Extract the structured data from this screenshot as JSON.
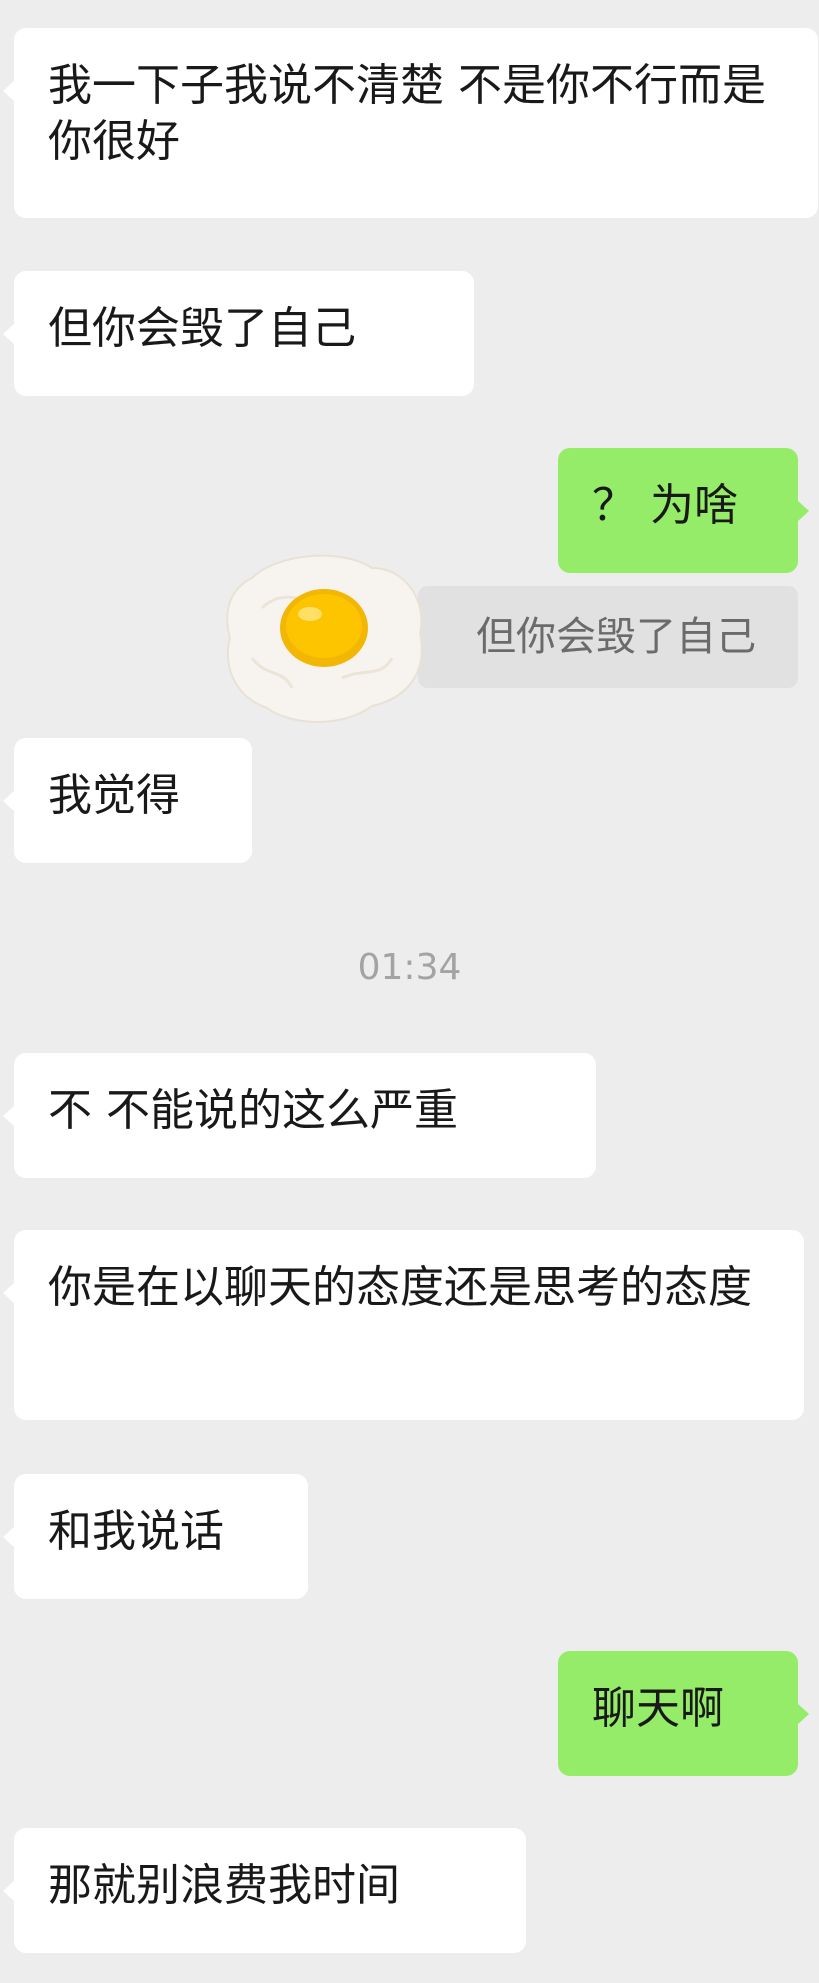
{
  "messages": [
    {
      "text": "我一下子我说不清楚 不是你不行而是你很好"
    },
    {
      "text": "但你会毁了自己"
    },
    {
      "text": "？ 为啥"
    },
    {
      "text": "我觉得"
    },
    {
      "text": "不 不能说的这么严重"
    },
    {
      "text": "你是在以聊天的态度还是思考的态度"
    },
    {
      "text": "和我说话"
    },
    {
      "text": "聊天啊"
    },
    {
      "text": "那就别浪费我时间"
    }
  ],
  "quoted_reply": {
    "text": "但你会毁了自己",
    "sticker_icon": "fried-egg-sticker"
  },
  "timestamp": "01:34",
  "colors": {
    "background": "#ededed",
    "incoming": "#ffffff",
    "outgoing": "#95ec69",
    "quote": "#e1e1e1"
  }
}
